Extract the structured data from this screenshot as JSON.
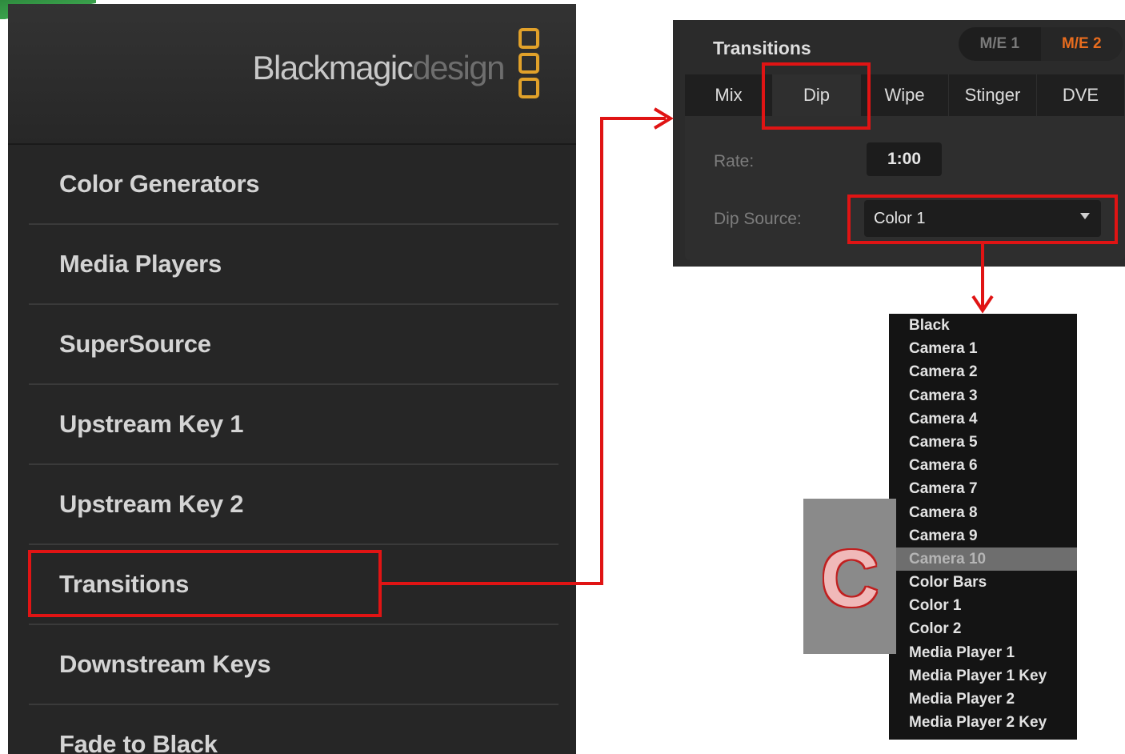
{
  "brand": {
    "name_bold": "Blackmagic",
    "name_light": "design"
  },
  "sidebar": {
    "items": [
      {
        "label": "Color Generators"
      },
      {
        "label": "Media Players"
      },
      {
        "label": "SuperSource"
      },
      {
        "label": "Upstream Key 1"
      },
      {
        "label": "Upstream Key 2"
      },
      {
        "label": "Transitions"
      },
      {
        "label": "Downstream Keys"
      },
      {
        "label": "Fade to Black"
      }
    ]
  },
  "transitions_panel": {
    "title": "Transitions",
    "me_buttons": [
      {
        "label": "M/E 1"
      },
      {
        "label": "M/E 2",
        "active": true
      }
    ],
    "tabs": [
      {
        "label": "Mix"
      },
      {
        "label": "Dip",
        "active": true
      },
      {
        "label": "Wipe"
      },
      {
        "label": "Stinger"
      },
      {
        "label": "DVE"
      }
    ],
    "rate_label": "Rate:",
    "rate_value": "1:00",
    "dip_source_label": "Dip Source:",
    "dip_source_value": "Color 1"
  },
  "dropdown": {
    "options": [
      "Black",
      "Camera 1",
      "Camera 2",
      "Camera 3",
      "Camera 4",
      "Camera 5",
      "Camera 6",
      "Camera 7",
      "Camera 8",
      "Camera 9",
      "Camera 10",
      "Color Bars",
      "Color 1",
      "Color 2",
      "Media Player 1",
      "Media Player 1 Key",
      "Media Player 2",
      "Media Player 2 Key"
    ],
    "highlighted": "Camera 10"
  },
  "badge": {
    "letter": "C"
  },
  "colors": {
    "highlight_red": "#e01414",
    "brand_orange": "#e1a12a",
    "active_me": "#e86c1e"
  }
}
